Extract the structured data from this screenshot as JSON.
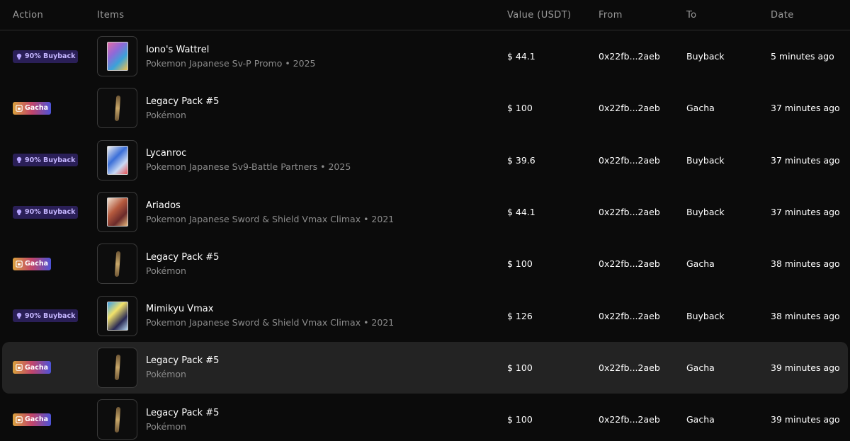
{
  "header": {
    "action": "Action",
    "items": "Items",
    "value": "Value (USDT)",
    "from": "From",
    "to": "To",
    "date": "Date"
  },
  "rows": [
    {
      "action": "90% Buyback",
      "action_type": "buyback",
      "name": "Iono's Wattrel",
      "sub": "Pokemon Japanese Sv-P Promo • 2025",
      "value": "$ 44.1",
      "from": "0x22fb...2aeb",
      "to": "Buyback",
      "date": "5 minutes ago",
      "thumb": "card-1"
    },
    {
      "action": "Gacha",
      "action_type": "gacha",
      "name": "Legacy Pack #5",
      "sub": "Pokémon",
      "value": "$ 100",
      "from": "0x22fb...2aeb",
      "to": "Gacha",
      "date": "37 minutes ago",
      "thumb": "pack"
    },
    {
      "action": "90% Buyback",
      "action_type": "buyback",
      "name": "Lycanroc",
      "sub": "Pokemon Japanese Sv9-Battle Partners • 2025",
      "value": "$ 39.6",
      "from": "0x22fb...2aeb",
      "to": "Buyback",
      "date": "37 minutes ago",
      "thumb": "card-2"
    },
    {
      "action": "90% Buyback",
      "action_type": "buyback",
      "name": "Ariados",
      "sub": "Pokemon Japanese Sword & Shield Vmax Climax • 2021",
      "value": "$ 44.1",
      "from": "0x22fb...2aeb",
      "to": "Buyback",
      "date": "37 minutes ago",
      "thumb": "card-3"
    },
    {
      "action": "Gacha",
      "action_type": "gacha",
      "name": "Legacy Pack #5",
      "sub": "Pokémon",
      "value": "$ 100",
      "from": "0x22fb...2aeb",
      "to": "Gacha",
      "date": "38 minutes ago",
      "thumb": "pack"
    },
    {
      "action": "90% Buyback",
      "action_type": "buyback",
      "name": "Mimikyu Vmax",
      "sub": "Pokemon Japanese Sword & Shield Vmax Climax • 2021",
      "value": "$ 126",
      "from": "0x22fb...2aeb",
      "to": "Buyback",
      "date": "38 minutes ago",
      "thumb": "card-4"
    },
    {
      "action": "Gacha",
      "action_type": "gacha",
      "name": "Legacy Pack #5",
      "sub": "Pokémon",
      "value": "$ 100",
      "from": "0x22fb...2aeb",
      "to": "Gacha",
      "date": "39 minutes ago",
      "thumb": "pack",
      "highlighted": true
    },
    {
      "action": "Gacha",
      "action_type": "gacha",
      "name": "Legacy Pack #5",
      "sub": "Pokémon",
      "value": "$ 100",
      "from": "0x22fb...2aeb",
      "to": "Gacha",
      "date": "39 minutes ago",
      "thumb": "pack"
    }
  ],
  "icons": {
    "buyback": "bulb-icon",
    "gacha": "gacha-box-icon"
  },
  "colors": {
    "background": "#0b0b0b",
    "buyback_badge": "#2a1f57",
    "buyback_text": "#c5b6ff",
    "muted": "#8c8c8c"
  }
}
